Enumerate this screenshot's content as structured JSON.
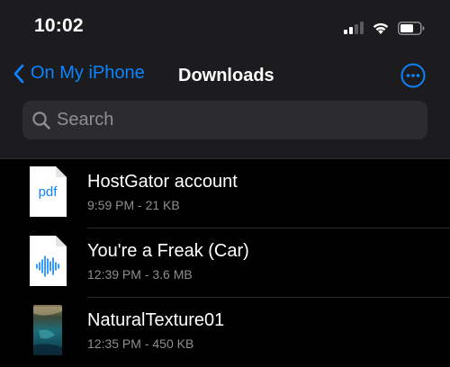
{
  "status_bar": {
    "time": "10:02",
    "icons": [
      "cellular-signal-icon",
      "wifi-icon",
      "battery-icon"
    ]
  },
  "nav": {
    "back_label": "On My iPhone",
    "title": "Downloads",
    "more_icon": "ellipsis-circle-icon"
  },
  "search": {
    "placeholder": "Search",
    "value": "",
    "icon": "magnifying-glass-icon"
  },
  "files": [
    {
      "name": "HostGator account",
      "meta": "9:59 PM - 21 KB",
      "type": "pdf",
      "type_label": "pdf",
      "icon": "pdf-document-icon"
    },
    {
      "name": "You're a Freak (Car)",
      "meta": "12:39 PM - 3.6 MB",
      "type": "audio",
      "icon": "audio-waveform-icon"
    },
    {
      "name": "NaturalTexture01",
      "meta": "12:35 PM - 450 KB",
      "type": "image",
      "icon": "image-thumbnail-icon"
    }
  ],
  "colors": {
    "accent": "#0a84ff",
    "background": "#000000",
    "header_background": "#1c1c1e",
    "search_background": "#2c2c2e",
    "secondary_text": "#8e8e93",
    "primary_text": "#ffffff"
  }
}
